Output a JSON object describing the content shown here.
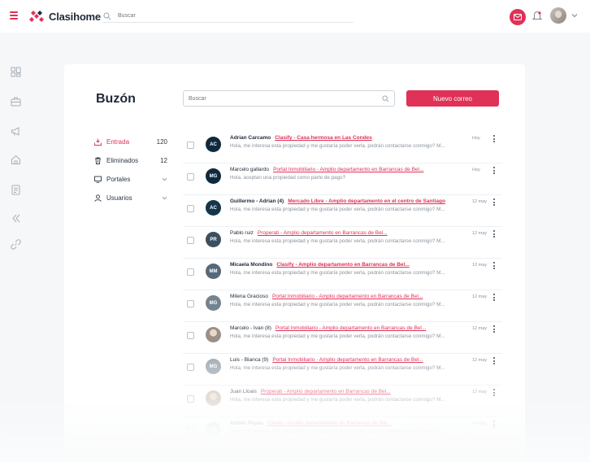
{
  "app": {
    "name": "Clasihome"
  },
  "top_search": {
    "placeholder": "Buscar"
  },
  "page": {
    "title": "Buzón"
  },
  "search": {
    "placeholder": "Buscar"
  },
  "new_button": {
    "label": "Nuevo correo"
  },
  "colors": {
    "accent": "#e03157",
    "text": "#1f2a37",
    "muted": "#8a939d"
  },
  "rail_icons": [
    "dashboard-icon",
    "briefcase-icon",
    "megaphone-icon",
    "home-icon",
    "document-icon",
    "chevrons-left-icon",
    "link-icon"
  ],
  "folders": [
    {
      "label": "Entrada",
      "count": "120",
      "icon": "inbox-icon",
      "active": true
    },
    {
      "label": "Eliminados",
      "count": "12",
      "icon": "trash-icon"
    },
    {
      "label": "Portales",
      "icon": "monitor-icon",
      "expandable": true
    },
    {
      "label": "Usuarios",
      "icon": "user-icon",
      "expandable": true
    }
  ],
  "messages": [
    {
      "initials": "AC",
      "color": "#0f2a3d",
      "sender": "Adrian Carcamo",
      "subject": "Clasify - Casa hermosa en Las Condes",
      "preview": "Hola, me interesa esta propiedad y me gustaría poder verla, podrán contactarse conmigo? M...",
      "date": "Hoy",
      "unread": true
    },
    {
      "initials": "MG",
      "color": "#0f2a3d",
      "sender": "Marcelo gallardo",
      "subject": "Portal Inmobiliario - Amplio departamento en Barrancas de Bel...",
      "preview": "Hola, aceptan una propiedad como parte de pago?",
      "date": "Hoy",
      "unread": false
    },
    {
      "initials": "AC",
      "color": "#15354a",
      "sender": "Guillermo - Adrian (4)",
      "subject": "Mercado Libre - Amplio departamento en el centro de Santiago",
      "preview": "Hola, me interesa esta propiedad y me gustaría poder verla, podrán contactarse conmigo? M...",
      "date": "12 may",
      "unread": true
    },
    {
      "initials": "PR",
      "color": "#3a4f5f",
      "sender": "Pablo ruiz",
      "subject": "Properati - Amplio departamento en Barrancas de Bel...",
      "preview": "Hola, me interesa esta propiedad y me gustaría poder verla, podrán contactarse conmigo? M...",
      "date": "12 may",
      "unread": false
    },
    {
      "initials": "MM",
      "color": "#55697a",
      "sender": "Micaela Mondino",
      "subject": "Clasify - Amplio departamento en Barrancas de Bel...",
      "preview": "Hola, me interesa esta propiedad y me gustaría poder verla, podrán contactarse conmigo? M...",
      "date": "12 may",
      "unread": true
    },
    {
      "initials": "MG",
      "color": "#73838f",
      "sender": "Milena Gracioso",
      "subject": "Portal Inmobiliario - Amplio departamento en Barrancas de Bel...",
      "preview": "Hola, me interesa esta propiedad y me gustaría poder verla, podrán contactarse conmigo? M...",
      "date": "12 may",
      "unread": false
    },
    {
      "initials": "",
      "color": "#9c8f86",
      "photo": true,
      "sender": "Marcelo - Ivan (8)",
      "subject": "Portal Inmobiliario - Amplio departamento en Barrancas de Bel...",
      "preview": "Hola, me interesa esta propiedad y me gustaría poder verla, podrán contactarse conmigo? M...",
      "date": "12 may",
      "unread": false
    },
    {
      "initials": "MG",
      "color": "#a6b0b8",
      "sender": "Luis - Bianca (9)",
      "subject": "Portal Inmobiliario - Amplio departamento en Barrancas de Bel...",
      "preview": "Hola, me interesa esta propiedad y me gustaría poder verla, podrán contactarse conmigo? M...",
      "date": "12 may",
      "unread": false
    },
    {
      "initials": "",
      "color": "#cbbfb6",
      "photo": true,
      "sender": "Juan Lloais",
      "subject": "Properati - Amplio departamento en Barrancas de Bel...",
      "preview": "Hola, me interesa esta propiedad y me gustaría poder verla, podrán contactarse conmigo? M...",
      "date": "12 may",
      "unread": false
    },
    {
      "initials": "AP",
      "color": "#c9d0d5",
      "sender": "Andrés Puyao",
      "subject": "Clasify - Amplio departamento en Barrancas de Bel...",
      "preview": "Hola, me interesa esta propiedad y me gustaría poder verla, podrán contactarse conmigo? M...",
      "date": "12 may",
      "unread": false
    }
  ]
}
